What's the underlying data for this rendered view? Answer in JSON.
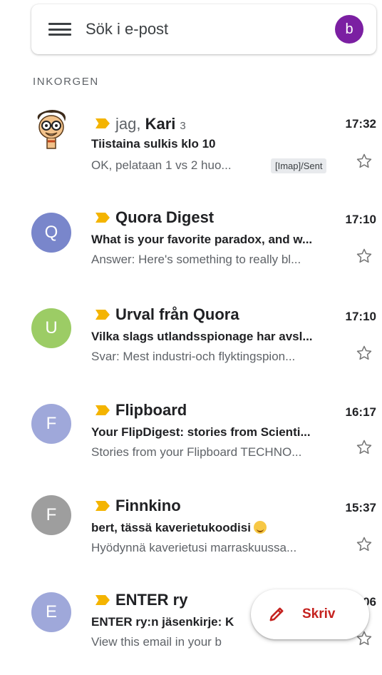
{
  "search": {
    "placeholder": "Sök i e-post",
    "account_initial": "b"
  },
  "section_label": "INKORGEN",
  "compose_label": "Skriv",
  "colors": {
    "accent": "#c5221f",
    "important": "#f4b400"
  },
  "mails": [
    {
      "avatar": "cartoon-avatar",
      "sender_prefix": "jag, ",
      "sender_name": "Kari",
      "thread_count": "3",
      "time": "17:32",
      "subject": "Tiistaina sulkis klo 10",
      "snippet": "OK, pelataan 1 vs 2 huo...",
      "label": "[Imap]/Sent",
      "unread": false
    },
    {
      "avatar_letter": "Q",
      "avatar_color": "#7986cb",
      "sender": "Quora Digest",
      "time": "17:10",
      "subject": "What is your favorite paradox, and w...",
      "snippet": "Answer: Here's something to really bl...",
      "unread": true
    },
    {
      "avatar_letter": "U",
      "avatar_color": "#9ccc65",
      "sender": "Urval från Quora",
      "time": "17:10",
      "subject": "Vilka slags utlandsspionage har avsl...",
      "snippet": "Svar: Mest industri-och flyktingspion...",
      "unread": true
    },
    {
      "avatar_letter": "F",
      "avatar_color": "#9fa8da",
      "sender": "Flipboard",
      "time": "16:17",
      "subject": "Your FlipDigest: stories from Scienti...",
      "snippet": "Stories from your Flipboard TECHNO...",
      "unread": true
    },
    {
      "avatar_letter": "F",
      "avatar_color": "#9e9e9e",
      "sender": "Finnkino",
      "time": "15:37",
      "subject": "bert, tässä kaverietukoodisi",
      "snippet": "Hyödynnä kaverietusi marraskuussa...",
      "unread": true
    },
    {
      "avatar_letter": "E",
      "avatar_color": "#9fa8da",
      "sender": "ENTER ry",
      "time": "09:06",
      "subject": "ENTER ry:n jäsenkirje: K",
      "snippet": "View this email in your b",
      "unread": true
    }
  ]
}
